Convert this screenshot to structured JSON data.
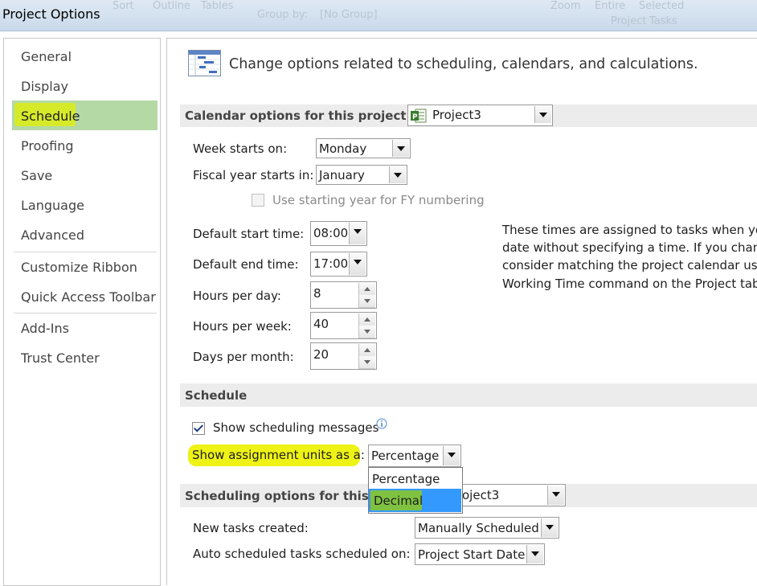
{
  "window": {
    "title": "Project Options",
    "background_ribbon": [
      "Sort",
      "Outline",
      "Tables",
      "Group by:",
      "[No Group]",
      "Zoom",
      "Entire",
      "Selected",
      "Project",
      "Tasks"
    ]
  },
  "sidebar": {
    "items": [
      {
        "label": "General"
      },
      {
        "label": "Display"
      },
      {
        "label": "Schedule",
        "selected": true
      },
      {
        "label": "Proofing"
      },
      {
        "label": "Save"
      },
      {
        "label": "Language"
      },
      {
        "label": "Advanced"
      },
      {
        "label": "Customize Ribbon"
      },
      {
        "label": "Quick Access Toolbar"
      },
      {
        "label": "Add-Ins"
      },
      {
        "label": "Trust Center"
      }
    ]
  },
  "main": {
    "heading": "Change options related to scheduling, calendars, and calculations.",
    "calendar_section": {
      "header": "Calendar options for this project:",
      "project": "Project3",
      "week_starts_label": "Week starts on:",
      "week_starts_value": "Monday",
      "fiscal_year_label": "Fiscal year starts in:",
      "fiscal_year_value": "January",
      "fy_numbering_label": "Use starting year for FY numbering",
      "fy_numbering_checked": false,
      "default_start_label": "Default start time:",
      "default_start_value": "08:00",
      "default_end_label": "Default end time:",
      "default_end_value": "17:00",
      "hours_per_day_label": "Hours per day:",
      "hours_per_day_value": "8",
      "hours_per_week_label": "Hours per week:",
      "hours_per_week_value": "40",
      "days_per_month_label": "Days per month:",
      "days_per_month_value": "20",
      "info_lines": [
        "These times are assigned to tasks when you",
        "date without specifying a time. If you chang",
        "consider matching the project calendar usi",
        "Working Time command on the Project tab"
      ]
    },
    "schedule_section": {
      "header": "Schedule",
      "show_messages_label": "Show scheduling messages",
      "show_messages_checked": true,
      "assignment_units_label": "Show assignment units as a:",
      "assignment_units_value": "Percentage",
      "assignment_units_options": [
        "Percentage",
        "Decimal"
      ],
      "assignment_units_highlighted": "Decimal"
    },
    "scheduling_options_section": {
      "header_visible": "Scheduling options for this p",
      "project_visible": "oject3",
      "new_tasks_label": "New tasks created:",
      "new_tasks_value": "Manually Scheduled",
      "auto_scheduled_label": "Auto scheduled tasks scheduled on:",
      "auto_scheduled_value": "Project Start Date"
    }
  },
  "colors": {
    "selected_nav": "#b4d9a5",
    "highlight_yellow": "#eef215",
    "highlight_green": "#7fc241",
    "list_selection": "#3399ff",
    "section_bg": "#ececec"
  }
}
